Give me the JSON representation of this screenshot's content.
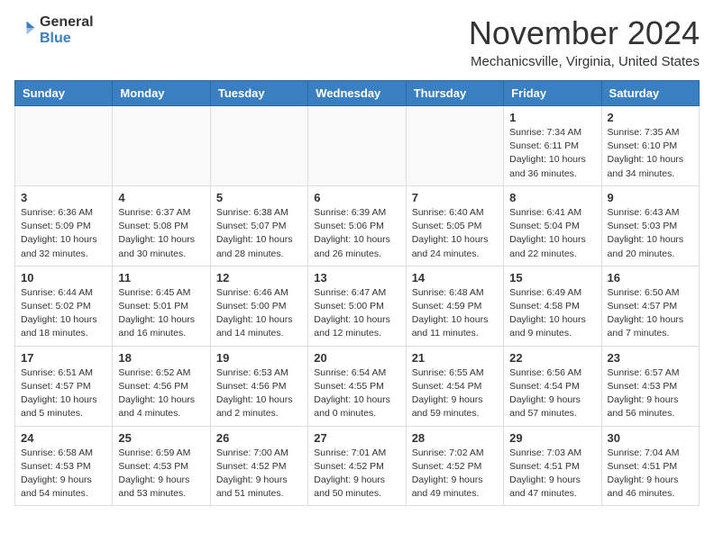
{
  "header": {
    "logo": {
      "general": "General",
      "blue": "Blue"
    },
    "title": "November 2024",
    "location": "Mechanicsville, Virginia, United States"
  },
  "weekdays": [
    "Sunday",
    "Monday",
    "Tuesday",
    "Wednesday",
    "Thursday",
    "Friday",
    "Saturday"
  ],
  "weeks": [
    [
      {
        "day": "",
        "info": ""
      },
      {
        "day": "",
        "info": ""
      },
      {
        "day": "",
        "info": ""
      },
      {
        "day": "",
        "info": ""
      },
      {
        "day": "",
        "info": ""
      },
      {
        "day": "1",
        "info": "Sunrise: 7:34 AM\nSunset: 6:11 PM\nDaylight: 10 hours and 36 minutes."
      },
      {
        "day": "2",
        "info": "Sunrise: 7:35 AM\nSunset: 6:10 PM\nDaylight: 10 hours and 34 minutes."
      }
    ],
    [
      {
        "day": "3",
        "info": "Sunrise: 6:36 AM\nSunset: 5:09 PM\nDaylight: 10 hours and 32 minutes."
      },
      {
        "day": "4",
        "info": "Sunrise: 6:37 AM\nSunset: 5:08 PM\nDaylight: 10 hours and 30 minutes."
      },
      {
        "day": "5",
        "info": "Sunrise: 6:38 AM\nSunset: 5:07 PM\nDaylight: 10 hours and 28 minutes."
      },
      {
        "day": "6",
        "info": "Sunrise: 6:39 AM\nSunset: 5:06 PM\nDaylight: 10 hours and 26 minutes."
      },
      {
        "day": "7",
        "info": "Sunrise: 6:40 AM\nSunset: 5:05 PM\nDaylight: 10 hours and 24 minutes."
      },
      {
        "day": "8",
        "info": "Sunrise: 6:41 AM\nSunset: 5:04 PM\nDaylight: 10 hours and 22 minutes."
      },
      {
        "day": "9",
        "info": "Sunrise: 6:43 AM\nSunset: 5:03 PM\nDaylight: 10 hours and 20 minutes."
      }
    ],
    [
      {
        "day": "10",
        "info": "Sunrise: 6:44 AM\nSunset: 5:02 PM\nDaylight: 10 hours and 18 minutes."
      },
      {
        "day": "11",
        "info": "Sunrise: 6:45 AM\nSunset: 5:01 PM\nDaylight: 10 hours and 16 minutes."
      },
      {
        "day": "12",
        "info": "Sunrise: 6:46 AM\nSunset: 5:00 PM\nDaylight: 10 hours and 14 minutes."
      },
      {
        "day": "13",
        "info": "Sunrise: 6:47 AM\nSunset: 5:00 PM\nDaylight: 10 hours and 12 minutes."
      },
      {
        "day": "14",
        "info": "Sunrise: 6:48 AM\nSunset: 4:59 PM\nDaylight: 10 hours and 11 minutes."
      },
      {
        "day": "15",
        "info": "Sunrise: 6:49 AM\nSunset: 4:58 PM\nDaylight: 10 hours and 9 minutes."
      },
      {
        "day": "16",
        "info": "Sunrise: 6:50 AM\nSunset: 4:57 PM\nDaylight: 10 hours and 7 minutes."
      }
    ],
    [
      {
        "day": "17",
        "info": "Sunrise: 6:51 AM\nSunset: 4:57 PM\nDaylight: 10 hours and 5 minutes."
      },
      {
        "day": "18",
        "info": "Sunrise: 6:52 AM\nSunset: 4:56 PM\nDaylight: 10 hours and 4 minutes."
      },
      {
        "day": "19",
        "info": "Sunrise: 6:53 AM\nSunset: 4:56 PM\nDaylight: 10 hours and 2 minutes."
      },
      {
        "day": "20",
        "info": "Sunrise: 6:54 AM\nSunset: 4:55 PM\nDaylight: 10 hours and 0 minutes."
      },
      {
        "day": "21",
        "info": "Sunrise: 6:55 AM\nSunset: 4:54 PM\nDaylight: 9 hours and 59 minutes."
      },
      {
        "day": "22",
        "info": "Sunrise: 6:56 AM\nSunset: 4:54 PM\nDaylight: 9 hours and 57 minutes."
      },
      {
        "day": "23",
        "info": "Sunrise: 6:57 AM\nSunset: 4:53 PM\nDaylight: 9 hours and 56 minutes."
      }
    ],
    [
      {
        "day": "24",
        "info": "Sunrise: 6:58 AM\nSunset: 4:53 PM\nDaylight: 9 hours and 54 minutes."
      },
      {
        "day": "25",
        "info": "Sunrise: 6:59 AM\nSunset: 4:53 PM\nDaylight: 9 hours and 53 minutes."
      },
      {
        "day": "26",
        "info": "Sunrise: 7:00 AM\nSunset: 4:52 PM\nDaylight: 9 hours and 51 minutes."
      },
      {
        "day": "27",
        "info": "Sunrise: 7:01 AM\nSunset: 4:52 PM\nDaylight: 9 hours and 50 minutes."
      },
      {
        "day": "28",
        "info": "Sunrise: 7:02 AM\nSunset: 4:52 PM\nDaylight: 9 hours and 49 minutes."
      },
      {
        "day": "29",
        "info": "Sunrise: 7:03 AM\nSunset: 4:51 PM\nDaylight: 9 hours and 47 minutes."
      },
      {
        "day": "30",
        "info": "Sunrise: 7:04 AM\nSunset: 4:51 PM\nDaylight: 9 hours and 46 minutes."
      }
    ]
  ]
}
